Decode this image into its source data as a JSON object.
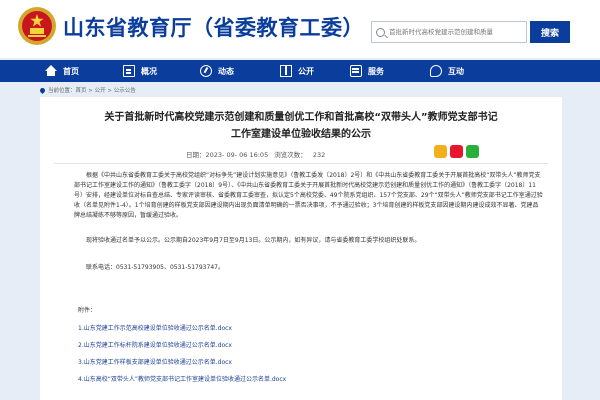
{
  "header": {
    "site_title": "山东省教育厅（省委教育工委）",
    "search_placeholder": "首批新时代高校党建示范创建和质量",
    "search_button": "搜索"
  },
  "nav": {
    "items": [
      {
        "label": "首页",
        "icon": "home-icon"
      },
      {
        "label": "概况",
        "icon": "overview-icon"
      },
      {
        "label": "动态",
        "icon": "news-icon"
      },
      {
        "label": "公开",
        "icon": "public-icon"
      },
      {
        "label": "服务",
        "icon": "service-icon"
      },
      {
        "label": "互动",
        "icon": "interact-icon"
      }
    ]
  },
  "breadcrumb": "当前位置：首页 > 公开 > 公示公告",
  "article": {
    "title_line1": "关于首批新时代高校党建示范创建和质量创优工作和首批高校“双带头人”教师党支部书记",
    "title_line2": "工作室建设单位验收结果的公示",
    "date": "日期：2023- 09- 06 16:05",
    "views_label": "浏览次数：",
    "views": "232",
    "paragraphs": [
      "根据《中共山东省委教育工委关于高校党组织“对标争先”建设计划实施意见》（鲁教工委发〔2018〕2号）和《中共山东省委教育工委关于开展首批高校“双带头人”教师党支部书记工作室建设工作的通知》（鲁教工委字〔2018〕9号）、《中共山东省委教育工委关于开展首批新时代高校党建示范创建和质量创优工作的通知》（鲁教工委字〔2018〕11号）安排，经建设单位对标自查总结、专家评读审核、省委教育工委审查，拟认定5个高校党委、49个院系党组织、157个党支部、29个“双带头人”教师党支部书记工作室通过验收（名单见附件1-4）。1个培育创建的样板党支部因建设期内出现负面清单明确的一票否决事项，不予通过验收；3个培育创建的样板党支部因建设期内建设成效不显著、党建品牌总结凝练不够等原因，暂缓通过验收。",
      "现将验收通过名单予以公示。公示期自2023年9月7日至9月13日。公示期内，如有异议，请与省委教育工委学校组织处联系。",
      "联系电话：0531-51793905、0531-51793747。"
    ],
    "attachments_label": "附件：",
    "attachments": [
      "1.山东党建工作示范高校建设单位验收通过公示名单.docx",
      "2.山东党建工作标杆院系建设单位验收通过公示名单.docx",
      "3.山东党建工作样板支部建设单位验收通过公示名单.docx",
      "4.山东高校“双带头人”教师党支部书记工作室建设单位验收通过公示名单.docx"
    ]
  },
  "colors": {
    "brand_blue": "#0a3d9c",
    "background": "#e6edf6",
    "link": "#1c3f95"
  }
}
